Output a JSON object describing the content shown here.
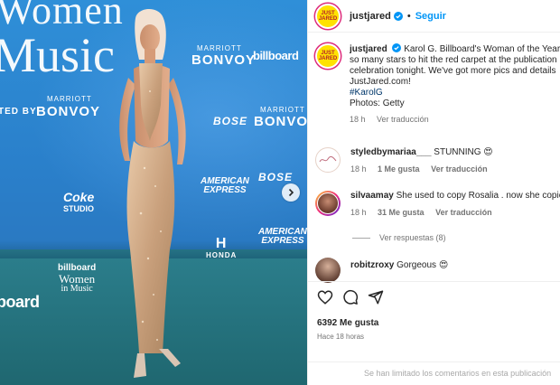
{
  "backdrop": {
    "women_title": "Women",
    "music_title": "Music",
    "edge_text_1": "TED BY",
    "marriott_small": "MARRIOTT",
    "bonvoy": "BONVOY",
    "billboard": "billboard",
    "bose": "BOSE",
    "amex_line1": "AMERICAN",
    "amex_line2": "EXPRESS",
    "coke_line1": "Coke",
    "coke_line2": "STUDIO",
    "honda": "HONDA",
    "billboard_women": "billboard",
    "billboard_women_line2": "Women",
    "billboard_women_line3": "in Music",
    "edge_text_2": "board"
  },
  "header": {
    "username": "justjared",
    "separator": "•",
    "follow_label": "Seguir",
    "avatar_text": "JUST JARED"
  },
  "caption": {
    "username": "justjared",
    "text": "Karol G. Billboard's Woman of the Year. So so many stars to hit the red carpet at the publication's celebration tonight. We've got more pics and details on JustJared.com!",
    "line1": "Karol G. Billboard's Woman of the Year.",
    "line2": "so many stars to hit the red carpet at the publication",
    "line3": "celebration tonight. We've got more pics and details",
    "line4": "JustJared.com!",
    "hashtag": "#KarolG",
    "photos": "Photos: Getty",
    "time": "18 h",
    "translate": "Ver traducción"
  },
  "comments": [
    {
      "username": "styledbymariaa___",
      "text": "STUNNING 😍",
      "time": "18 h",
      "likes": "1 Me gusta",
      "translate": "Ver traducción"
    },
    {
      "username": "silvaamay",
      "text": "She used to copy Rosalia . now she copie",
      "time": "18 h",
      "likes": "31 Me gusta",
      "translate": "Ver traducción"
    },
    {
      "username": "robitzroxy",
      "text": "Gorgeous 😍"
    }
  ],
  "replies_label": "Ver respuestas (8)",
  "actions": {
    "likes": "6392 Me gusta",
    "time": "Hace 18 horas",
    "limited": "Se han limitado los comentarios en esta publicación"
  },
  "colors": {
    "link": "#0095f6",
    "muted": "#737373",
    "hashtag": "#00376b",
    "backdrop_blue": "#2a7fca",
    "carpet": "#2c7f8d"
  }
}
